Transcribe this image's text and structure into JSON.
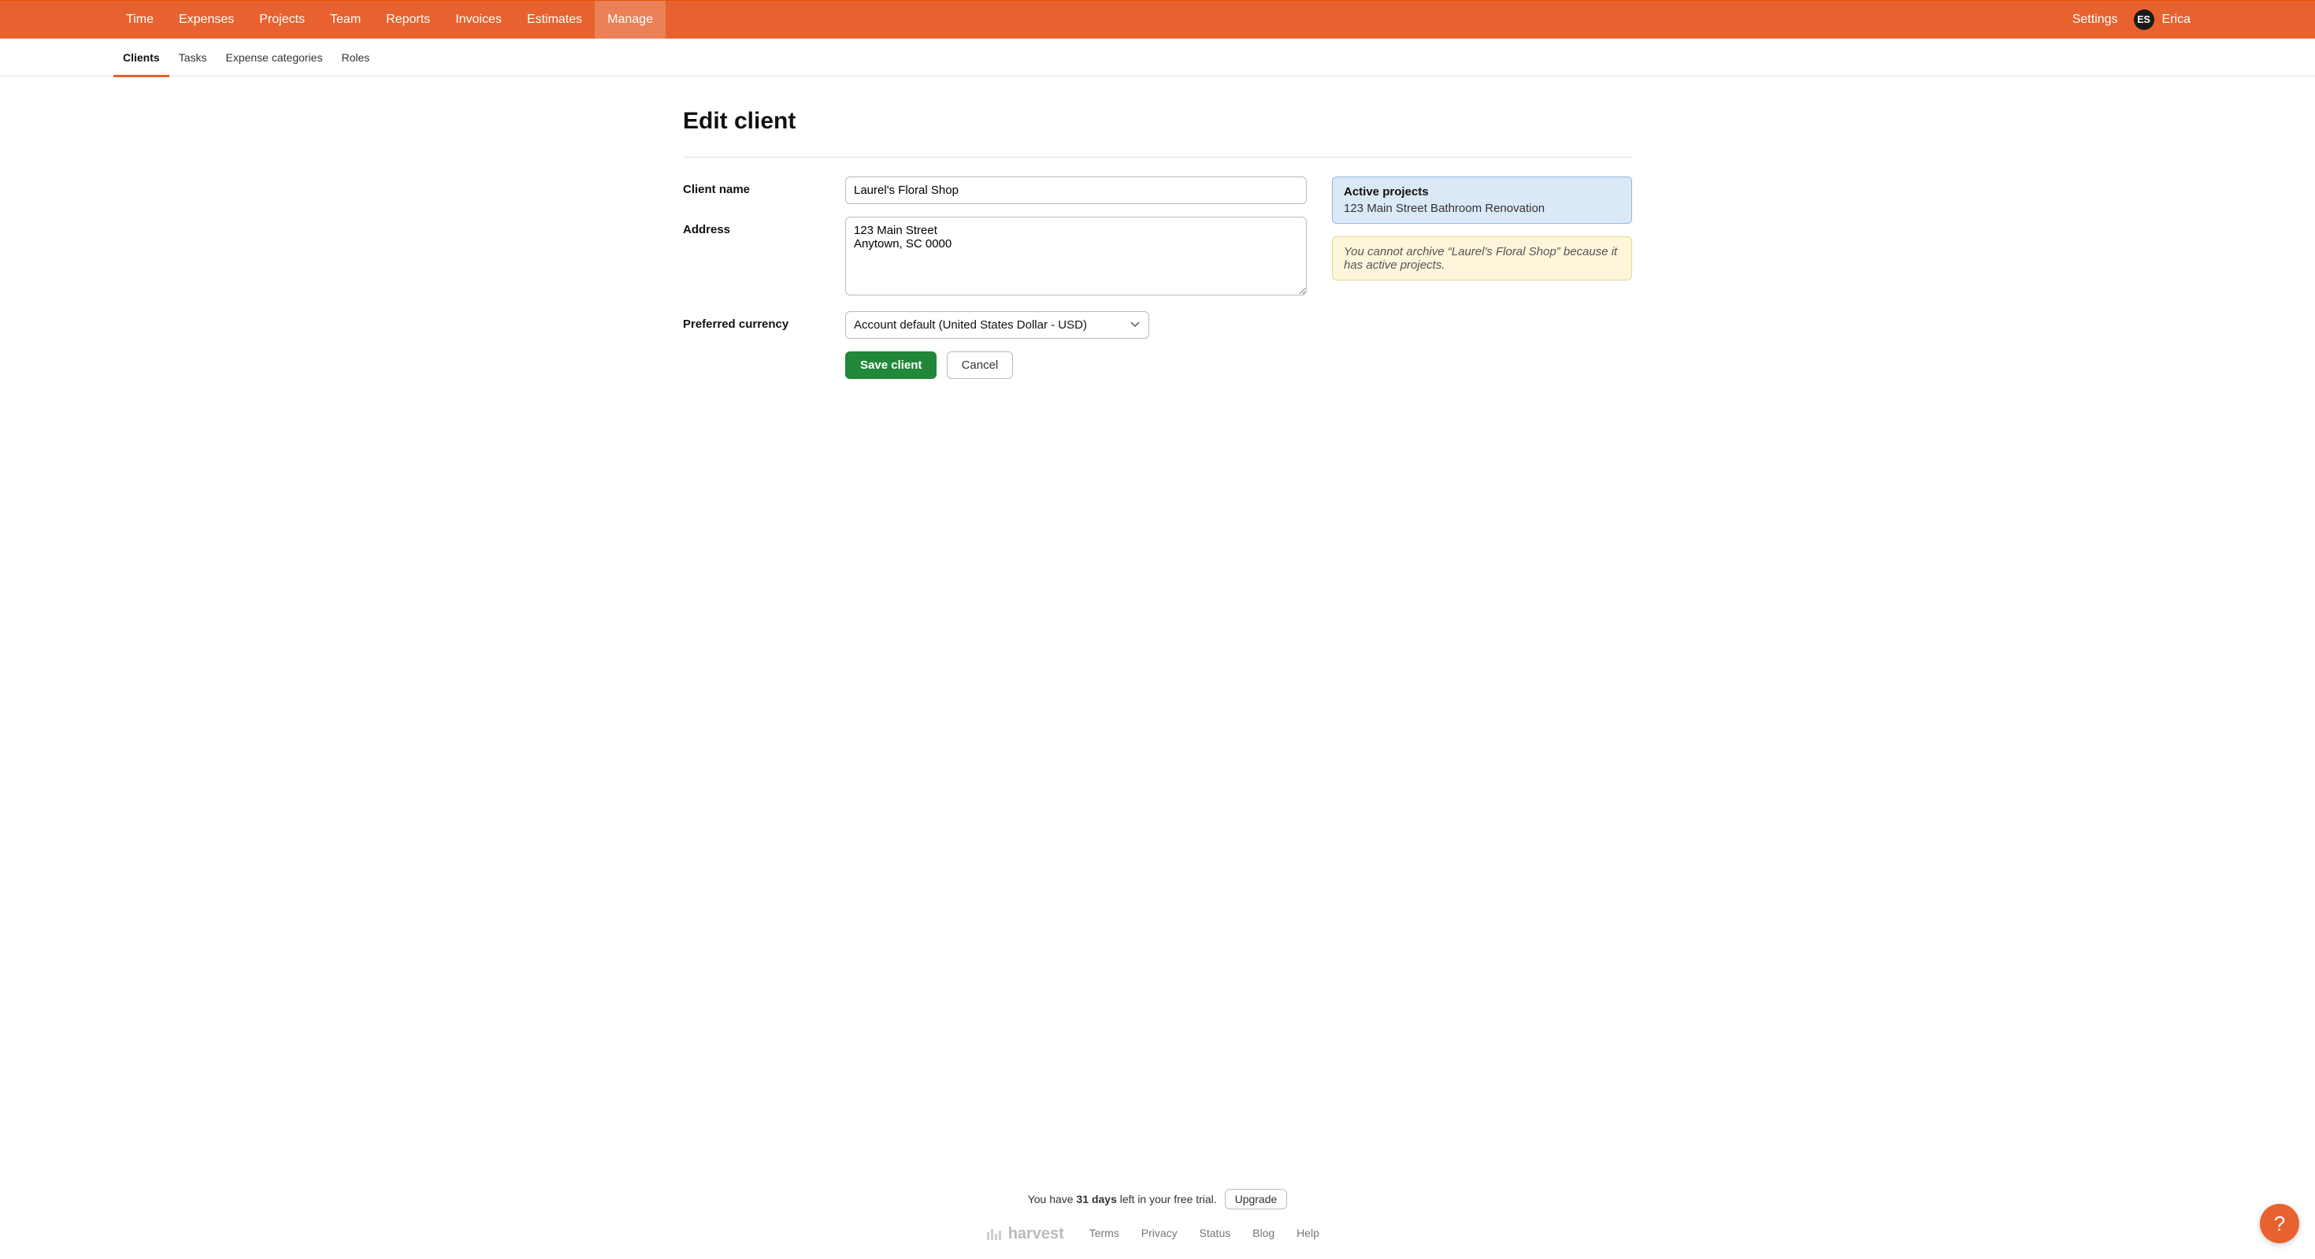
{
  "nav": {
    "items": [
      {
        "label": "Time"
      },
      {
        "label": "Expenses"
      },
      {
        "label": "Projects"
      },
      {
        "label": "Team"
      },
      {
        "label": "Reports"
      },
      {
        "label": "Invoices"
      },
      {
        "label": "Estimates"
      },
      {
        "label": "Manage"
      }
    ],
    "settings": "Settings",
    "avatar": "ES",
    "username": "Erica"
  },
  "subnav": {
    "items": [
      {
        "label": "Clients"
      },
      {
        "label": "Tasks"
      },
      {
        "label": "Expense categories"
      },
      {
        "label": "Roles"
      }
    ]
  },
  "page": {
    "title": "Edit client",
    "labels": {
      "client_name": "Client name",
      "address": "Address",
      "preferred_currency": "Preferred currency"
    },
    "fields": {
      "client_name": "Laurel's Floral Shop",
      "address": "123 Main Street\nAnytown, SC 0000",
      "currency": "Account default (United States Dollar - USD)"
    },
    "buttons": {
      "save": "Save client",
      "cancel": "Cancel"
    }
  },
  "side": {
    "active_projects_title": "Active projects",
    "active_projects": [
      "123 Main Street Bathroom Renovation"
    ],
    "archive_warning": "You cannot archive “Laurel's Floral Shop” because it has active projects."
  },
  "footer": {
    "trial_prefix": "You have ",
    "trial_days": "31 days",
    "trial_suffix": " left in your free trial.",
    "upgrade": "Upgrade",
    "brand": "harvest",
    "links": [
      "Terms",
      "Privacy",
      "Status",
      "Blog",
      "Help"
    ]
  },
  "help": {
    "glyph": "?"
  }
}
